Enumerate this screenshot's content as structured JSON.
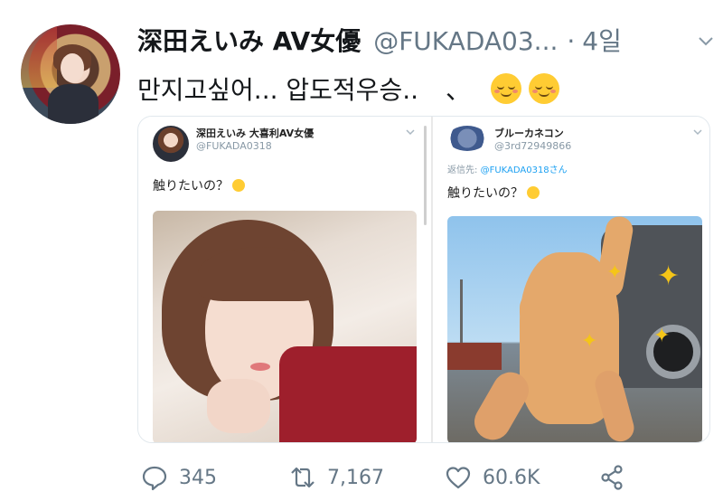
{
  "tweet": {
    "author_name": "深田えいみ AV女優",
    "author_handle": "@FUKADA03...",
    "separator": "·",
    "time": "4일",
    "text": "만지고싶어... 압도적우승..",
    "text_suffix": "、",
    "emoji": [
      "relieved-face",
      "relieved-face"
    ]
  },
  "media": {
    "left": {
      "name": "深田えいみ 大喜利AV女優",
      "handle": "@FUKADA0318",
      "text": "触りたいの？",
      "emoji": "relieved-face"
    },
    "right": {
      "name": "ブルーカネコン",
      "handle": "@3rd72949866",
      "reply_prefix": "返信先:",
      "reply_to": "@FUKADA0318さん",
      "text": "触りたいの？",
      "emoji": "relieved-face"
    }
  },
  "actions": {
    "reply_count": "345",
    "retweet_count": "7,167",
    "like_count": "60.6K"
  },
  "colors": {
    "text_primary": "#14171a",
    "text_secondary": "#657786",
    "link": "#1da1f2",
    "emoji": "#ffcc33"
  }
}
